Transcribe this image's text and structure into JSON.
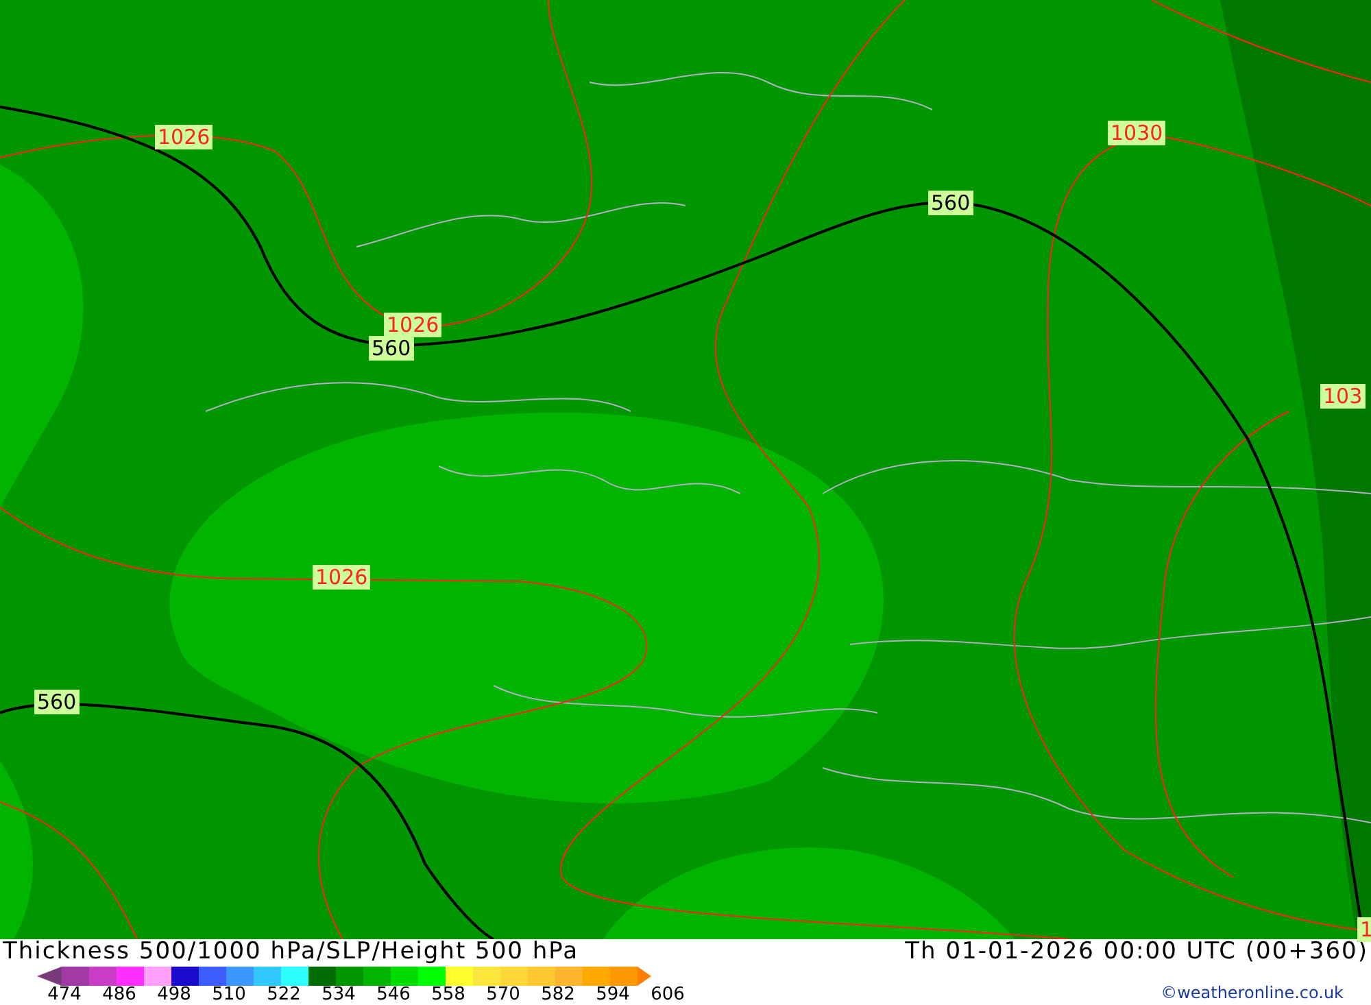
{
  "map": {
    "contour_labels": [
      {
        "text": "1026",
        "kind": "pressure"
      },
      {
        "text": "1030",
        "kind": "pressure"
      },
      {
        "text": "560",
        "kind": "height"
      },
      {
        "text": "1026",
        "kind": "pressure"
      },
      {
        "text": "560",
        "kind": "height"
      },
      {
        "text": "103",
        "kind": "pressure"
      },
      {
        "text": "1026",
        "kind": "pressure"
      },
      {
        "text": "560",
        "kind": "height"
      },
      {
        "text": "1",
        "kind": "pressure"
      }
    ]
  },
  "title": "Thickness 500/1000 hPa/SLP/Height 500 hPa",
  "valid_time": "Th 01-01-2026 00:00 UTC (00+360)",
  "legend": {
    "swatches": [
      {
        "color": "#7a3a7a",
        "kind": "arrow-left"
      },
      {
        "color": "#a33aa3",
        "kind": "box"
      },
      {
        "color": "#c83cc8",
        "kind": "box"
      },
      {
        "color": "#ff30ff",
        "kind": "box"
      },
      {
        "color": "#ffa0ff",
        "kind": "box"
      },
      {
        "color": "#1a0acc",
        "kind": "box"
      },
      {
        "color": "#3c5cff",
        "kind": "box"
      },
      {
        "color": "#3c98ff",
        "kind": "box"
      },
      {
        "color": "#30c8ff",
        "kind": "box"
      },
      {
        "color": "#30ffff",
        "kind": "box"
      },
      {
        "color": "#006e00",
        "kind": "box"
      },
      {
        "color": "#009600",
        "kind": "box"
      },
      {
        "color": "#00b400",
        "kind": "box"
      },
      {
        "color": "#00dc00",
        "kind": "box"
      },
      {
        "color": "#00ff00",
        "kind": "box"
      },
      {
        "color": "#ffff30",
        "kind": "box"
      },
      {
        "color": "#ffe63c",
        "kind": "box"
      },
      {
        "color": "#ffd838",
        "kind": "box"
      },
      {
        "color": "#ffc830",
        "kind": "box"
      },
      {
        "color": "#ffb430",
        "kind": "box"
      },
      {
        "color": "#ffa800",
        "kind": "box"
      },
      {
        "color": "#ff9800",
        "kind": "box"
      },
      {
        "color": "#ff8000",
        "kind": "arrow-right"
      }
    ],
    "ticks": [
      "474",
      "486",
      "498",
      "510",
      "522",
      "534",
      "546",
      "558",
      "570",
      "582",
      "594",
      "606"
    ]
  },
  "credit": "©weatheronline.co.uk"
}
